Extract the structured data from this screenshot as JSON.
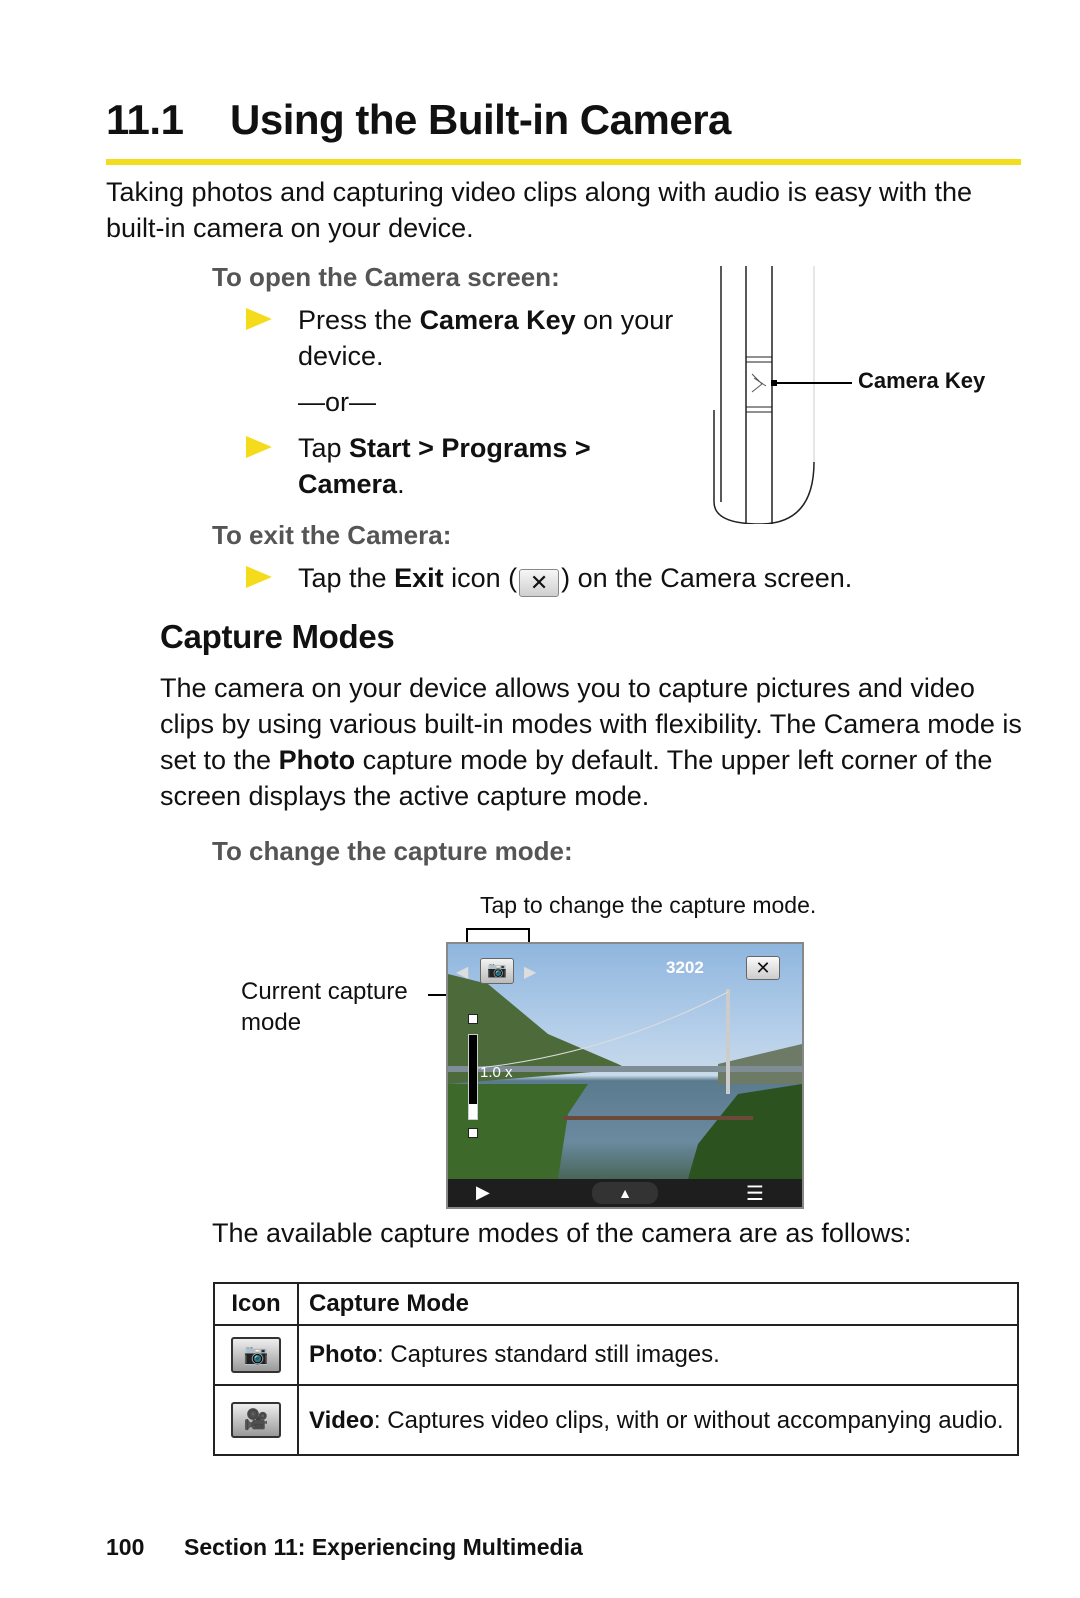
{
  "header": {
    "section_number": "11.1",
    "title": "Using the Built-in Camera",
    "rule_color": "#f3dd1f"
  },
  "intro": "Taking photos and capturing video clips along with audio is easy with the built-in camera on your device.",
  "open_camera": {
    "heading": "To open the Camera screen:",
    "step1": {
      "pre": "Press the ",
      "bold": "Camera Key",
      "post": " on your device."
    },
    "or": "—or—",
    "step2": {
      "pre": "Tap ",
      "bold1": "Start > Programs > ",
      "bold2": "Camera",
      "post": "."
    },
    "bullet_icon": "yellow-triangle-bullet",
    "bullet_color": "#f4dc1c"
  },
  "device_figure": {
    "callout": "Camera Key"
  },
  "exit_camera": {
    "heading": "To exit the Camera:",
    "step": {
      "pre": "Tap the ",
      "bold": "Exit",
      "mid": " icon (",
      "icon_glyph": "✕",
      "post": ") on the Camera screen."
    }
  },
  "capture_modes": {
    "heading": "Capture Modes",
    "para": {
      "pre": "The camera on your device allows you to capture pictures and video clips by using various built-in modes with flexibility. The Camera mode is set to the ",
      "bold": "Photo",
      "post": " capture mode by default. The upper left corner of the screen displays the active capture mode."
    },
    "change_heading": "To change the capture mode:"
  },
  "camera_figure": {
    "callout_top": "Tap to change the capture mode.",
    "callout_left": "Current capture mode",
    "shots_remaining": "3202",
    "zoom_level": "1.0 x",
    "exit_glyph": "✕"
  },
  "modes_intro": "The available capture modes of the camera are as follows:",
  "modes_table": {
    "headers": [
      "Icon",
      "Capture Mode"
    ],
    "rows": [
      {
        "icon": "photo-mode-icon",
        "name": "Photo",
        "desc": ": Captures standard still images."
      },
      {
        "icon": "video-mode-icon",
        "name": "Video",
        "desc": ": Captures video clips, with or without accompanying audio."
      }
    ]
  },
  "footer": {
    "page_number": "100",
    "section": "Section 11: Experiencing Multimedia"
  }
}
